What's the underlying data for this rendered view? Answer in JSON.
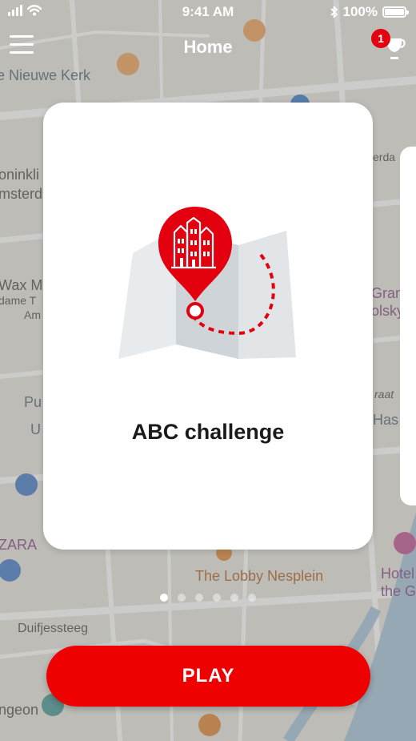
{
  "status_bar": {
    "time": "9:41 AM",
    "battery_percent": "100%"
  },
  "header": {
    "title": "Home",
    "menu_icon": "hamburger-menu-icon",
    "trophy_icon": "trophy-icon",
    "notification_count": "1"
  },
  "map_labels": [
    "e Nieuwe Kerk",
    "oninkli",
    "msterd",
    "Wax Mu",
    "dame T",
    "Am",
    "Pu",
    "U",
    "ZARA",
    "Duifjessteeg",
    "ngeon",
    "The Lobby Nesplein",
    "Hotel",
    "the G",
    "Gran",
    "olsky",
    "raat",
    "Has",
    "erda"
  ],
  "card": {
    "title": "ABC challenge",
    "illustration": "map-pin-canal-houses-icon"
  },
  "pager": {
    "count": 6,
    "active_index": 0
  },
  "play_button": {
    "label": "PLAY"
  },
  "colors": {
    "accent_red": "#ee0000",
    "badge_red": "#e3000f"
  }
}
